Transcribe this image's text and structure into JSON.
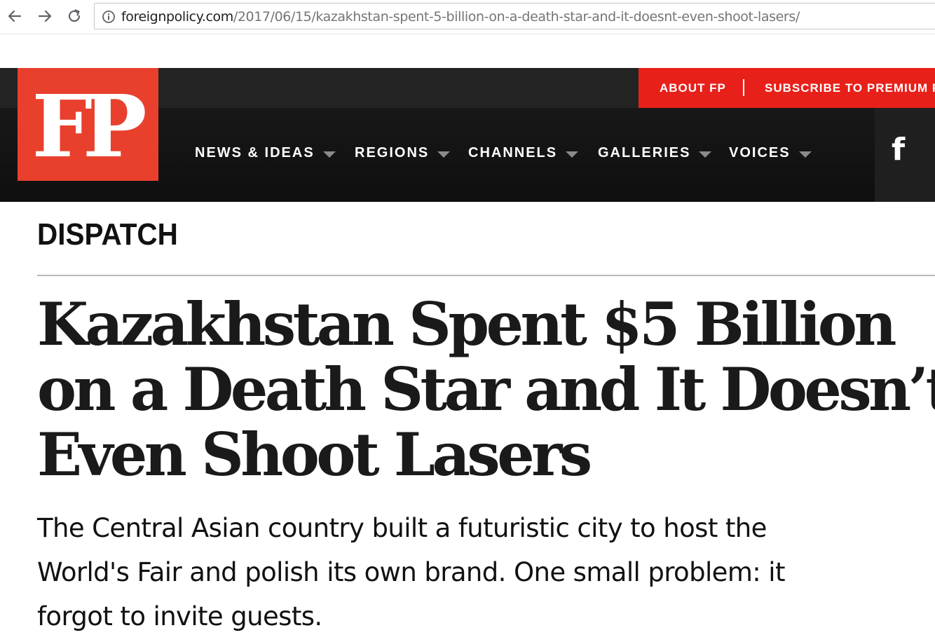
{
  "browser": {
    "url_host": "foreignpolicy.com",
    "url_path": "/2017/06/15/kazakhstan-spent-5-billion-on-a-death-star-and-it-doesnt-even-shoot-lasers/"
  },
  "header": {
    "logo_text": "FP",
    "utility_links": [
      "ABOUT FP",
      "SUBSCRIBE TO PREMIUM FO"
    ],
    "nav_items": [
      "NEWS & IDEAS",
      "REGIONS",
      "CHANNELS",
      "GALLERIES",
      "VOICES"
    ],
    "social_icon": "f"
  },
  "article": {
    "section": "DISPATCH",
    "headline_lines": [
      "Kazakhstan Spent $5 Billion",
      "on a Death Star and It Doesn’t",
      "Even Shoot Lasers"
    ],
    "dek_lines": [
      "The Central Asian country built a futuristic city to host the",
      "World's Fair and polish its own brand. One small problem: it",
      "forgot to invite guests."
    ]
  },
  "colors": {
    "brand_red": "#e8402d",
    "utility_red": "#e8201a",
    "header_dark": "#111111"
  }
}
